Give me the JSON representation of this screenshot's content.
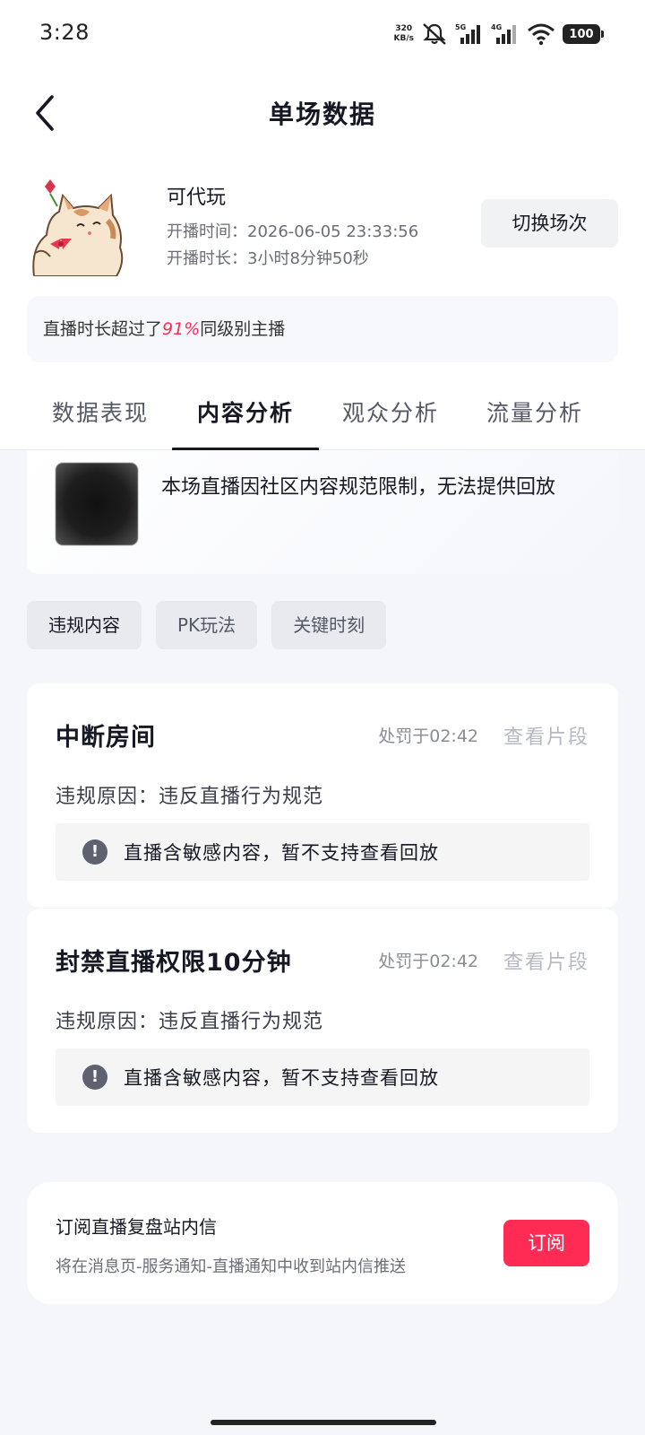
{
  "status_bar": {
    "time": "3:28",
    "net_speed_value": "320",
    "net_speed_unit": "KB/s",
    "battery": "100"
  },
  "header": {
    "title": "单场数据"
  },
  "session": {
    "host_name": "可代玩",
    "start_time": "开播时间：2026-06-05 23:33:56",
    "duration": "开播时长：3小时8分钟50秒",
    "switch_label": "切换场次"
  },
  "rank": {
    "prefix": "直播时长超过了",
    "percent": "91%",
    "suffix": "同级别主播"
  },
  "tabs": [
    {
      "label": "数据表现"
    },
    {
      "label": "内容分析"
    },
    {
      "label": "观众分析"
    },
    {
      "label": "流量分析"
    }
  ],
  "replay": {
    "notice": "本场直播因社区内容规范限制，无法提供回放"
  },
  "chips": [
    {
      "label": "违规内容"
    },
    {
      "label": "PK玩法"
    },
    {
      "label": "关键时刻"
    }
  ],
  "violations": [
    {
      "title": "中断房间",
      "time": "处罚于02:42",
      "link": "查看片段",
      "reason": "违规原因：违反直播行为规范",
      "notice": "直播含敏感内容，暂不支持查看回放"
    },
    {
      "title": "封禁直播权限10分钟",
      "time": "处罚于02:42",
      "link": "查看片段",
      "reason": "违规原因：违反直播行为规范",
      "notice": "直播含敏感内容，暂不支持查看回放"
    }
  ],
  "subscribe": {
    "title": "订阅直播复盘站内信",
    "description": "将在消息页-服务通知-直播通知中收到站内信推送",
    "button": "订阅"
  },
  "colors": {
    "accent": "#fe2c55",
    "text_primary": "#161823",
    "page_background": "#f5f6fa"
  }
}
